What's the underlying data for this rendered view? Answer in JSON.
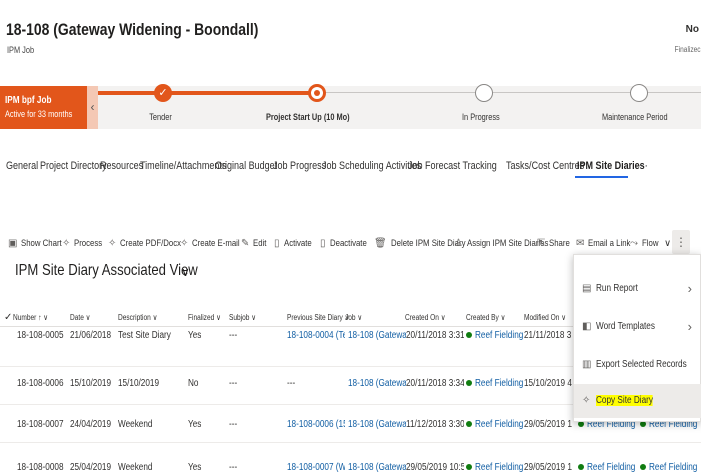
{
  "header": {
    "title": "18-108 (Gateway Widening - Boondall)",
    "subtitle": "IPM Job",
    "right_value": "No",
    "right_label": "Finalizec"
  },
  "bpf": {
    "stage_name": "IPM bpf Job",
    "stage_status": "Active for 33 months",
    "stages": [
      {
        "label": "Tender"
      },
      {
        "label": "Project Start Up (10 Mo)"
      },
      {
        "label": "In Progress"
      },
      {
        "label": "Maintenance Period"
      }
    ],
    "accent": "#e2561b"
  },
  "tabs": [
    "General",
    "Project Directory",
    "Resources",
    "Timeline/Attachments",
    "Original Budget",
    "Job Progress",
    "Job Scheduling Activities",
    "Job Forecast Tracking",
    "Tasks/Cost Centres",
    "IPM Site Diaries",
    "···"
  ],
  "commands": [
    "Show Chart",
    "Process",
    "Create PDF/Docx",
    "Create E-mail",
    "Edit",
    "Activate",
    "Deactivate",
    "Delete IPM Site Diary",
    "Assign IPM Site Diaries",
    "Share",
    "Email a Link",
    "Flow",
    "⋮"
  ],
  "view": {
    "title": "IPM Site Diary Associated View",
    "chevron": "∨"
  },
  "columns": [
    "Number ↑ ∨",
    "Date ∨",
    "Description ∨",
    "Finalized ∨",
    "Subjob ∨",
    "Previous Site Diary ∨",
    "Job ∨",
    "Created On ∨",
    "Created By ∨",
    "Modified On ∨"
  ],
  "rows": [
    {
      "number": "18-108-0005",
      "date": "21/06/2018",
      "description": "Test Site Diary",
      "finalized": "Yes",
      "subjob": "---",
      "previous": "18-108-0004 (Test Site",
      "job": "18-108 (Gateway Wid",
      "created_on": "20/11/2018 3:31...",
      "created_by": "Reef Fielding",
      "modified_on": "21/11/2018 3:54..."
    },
    {
      "number": "18-108-0006",
      "date": "15/10/2019",
      "description": "15/10/2019",
      "finalized": "No",
      "subjob": "---",
      "previous": "---",
      "job": "18-108 (Gateway Wid",
      "created_on": "20/11/2018 3:34...",
      "created_by": "Reef Fielding",
      "modified_on": "15/10/2019 4:16..."
    },
    {
      "number": "18-108-0007",
      "date": "24/04/2019",
      "description": "Weekend",
      "finalized": "Yes",
      "subjob": "---",
      "previous": "18-108-0006 (15/10/2",
      "job": "18-108 (Gateway Wid",
      "created_on": "11/12/2018 3:30...",
      "created_by": "Reef Fielding",
      "modified_on": "29/05/2019 11:1...",
      "extra1": "Reef Fielding",
      "extra2": "Reef Fielding"
    },
    {
      "number": "18-108-0008",
      "date": "25/04/2019",
      "description": "Weekend",
      "finalized": "Yes",
      "subjob": "---",
      "previous": "18-108-0007 (Weeken",
      "job": "18-108 (Gateway Wid",
      "created_on": "29/05/2019 10:5...",
      "created_by": "Reef Fielding",
      "modified_on": "29/05/2019 11:0...",
      "extra1": "Reef Fielding",
      "extra2": "Reef Fielding"
    }
  ],
  "menu": {
    "items": [
      {
        "label": "Run Report",
        "icon": "report-icon",
        "has_submenu": true
      },
      {
        "label": "Word Templates",
        "icon": "word-icon",
        "has_submenu": true
      },
      {
        "label": "Export Selected Records",
        "icon": "export-icon",
        "has_submenu": false
      },
      {
        "label": "Copy Site Diary",
        "icon": "copy-icon",
        "has_submenu": false
      }
    ]
  }
}
